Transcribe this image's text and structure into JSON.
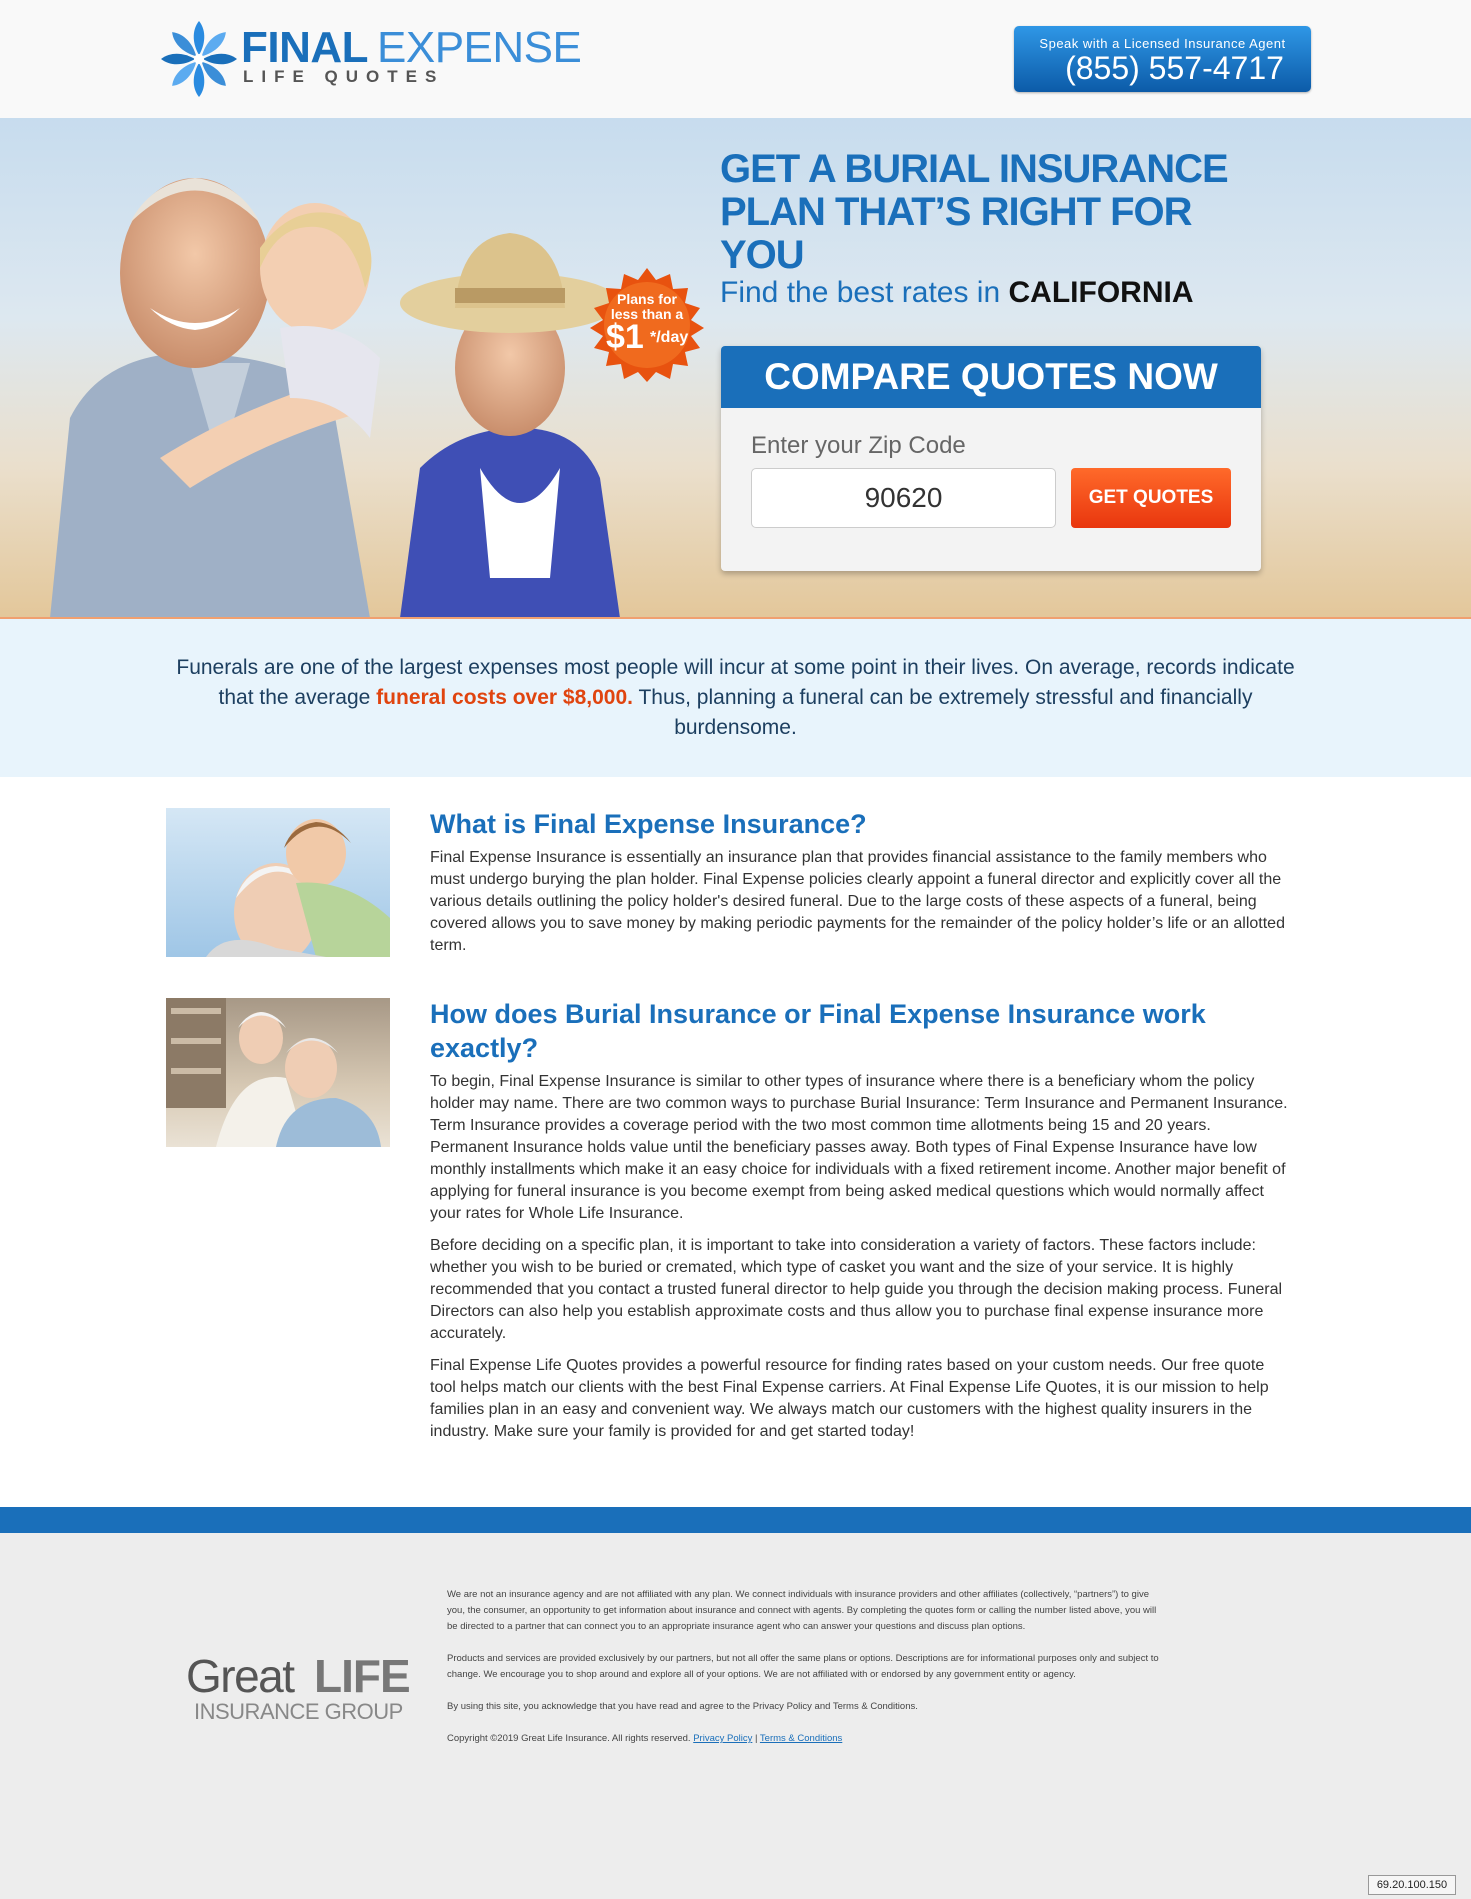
{
  "header": {
    "logo_final": "FINAL",
    "logo_expense": "EXPENSE",
    "logo_sub": "LIFE QUOTES",
    "agent_label": "Speak with a Licensed Insurance Agent",
    "agent_phone": "(855) 557-4717"
  },
  "hero": {
    "badge_line1": "Plans for",
    "badge_line2": "less than a",
    "badge_amount": "$1",
    "badge_per": "*/day",
    "title": "GET A BURIAL INSURANCE PLAN THAT’S RIGHT FOR YOU",
    "subtitle": "Find the best rates in",
    "state": "CALIFORNIA"
  },
  "quote_form": {
    "heading": "COMPARE QUOTES NOW",
    "zip_label": "Enter your Zip Code",
    "zip_value": "90620",
    "button_label": "GET QUOTES"
  },
  "intro": {
    "text_before": "Funerals are one of the largest expenses most people will incur at some point in their lives. On average, records indicate that the average ",
    "highlight": "funeral costs over $8,000.",
    "text_after": " Thus, planning a funeral can be extremely stressful and financially burdensome."
  },
  "sections": [
    {
      "title": "What is Final Expense Insurance?",
      "paragraphs": [
        "Final Expense Insurance is essentially an insurance plan that provides financial assistance to the family members who must undergo burying the plan holder. Final Expense policies clearly appoint a funeral director and explicitly cover all the various details outlining the policy holder's desired funeral. Due to the large costs of these aspects of a funeral, being covered allows you to save money by making periodic payments for the remainder of the policy holder’s life or an allotted term."
      ]
    },
    {
      "title": "How does Burial Insurance or Final Expense Insurance work exactly?",
      "paragraphs": [
        "To begin, Final Expense Insurance is similar to other types of insurance where there is a beneficiary whom the policy holder may name. There are two common ways to purchase Burial Insurance: Term Insurance and Permanent Insurance. Term Insurance provides a coverage period with the two most common time allotments being 15 and 20 years. Permanent Insurance holds value until the beneficiary passes away. Both types of Final Expense Insurance have low monthly installments which make it an easy choice for individuals with a fixed retirement income. Another major benefit of applying for funeral insurance is you become exempt from being asked medical questions which would normally affect your rates for Whole Life Insurance.",
        "Before deciding on a specific plan, it is important to take into consideration a variety of factors. These factors include: whether you wish to be buried or cremated, which type of casket you want and the size of your service. It is highly recommended that you contact a trusted funeral director to help guide you through the decision making process. Funeral Directors can also help you establish approximate costs and thus allow you to purchase final expense insurance more accurately.",
        "Final Expense Life Quotes provides a powerful resource for finding rates based on your custom needs. Our free quote tool helps match our clients with the best Final Expense carriers. At Final Expense Life Quotes, it is our mission to help families plan in an easy and convenient way. We always match our customers with the highest quality insurers in the industry. Make sure your family is provided for and get started today!"
      ]
    }
  ],
  "footer": {
    "logo_great": "Great",
    "logo_life": "LIFE",
    "logo_sub": "INSURANCE GROUP",
    "disclaimer1": "We are not an insurance agency and are not affiliated with any plan. We connect individuals with insurance providers and other affiliates (collectively, “partners”) to give you, the consumer, an opportunity to get information about insurance and connect with agents. By completing the quotes form or calling the number listed above, you will be directed to a partner that can connect you to an appropriate insurance agent who can answer your questions and discuss plan options.",
    "disclaimer2": "Products and services are provided exclusively by our partners, but not all offer the same plans or options. Descriptions are for informational purposes only and subject to change. We encourage you to shop around and explore all of your options. We are not affiliated with or endorsed by any government entity or agency.",
    "disclaimer3": "By using this site, you acknowledge that you have read and agree to the Privacy Policy and Terms & Conditions.",
    "copyright": "Copyright ©2019 Great Life Insurance. All rights reserved.",
    "privacy_link": "Privacy Policy",
    "separator": "|",
    "terms_link": "Terms & Conditions",
    "ip": "69.20.100.150"
  },
  "colors": {
    "brand_blue": "#1a6fba",
    "accent_orange": "#e9360e",
    "intro_bg": "#e8f4fc"
  }
}
